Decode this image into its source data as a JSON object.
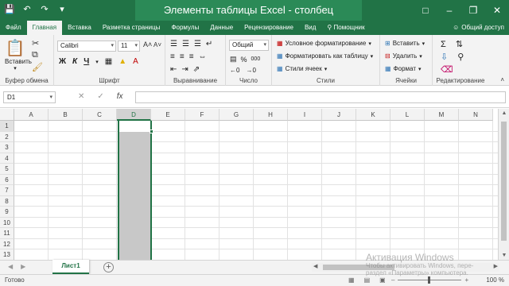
{
  "window": {
    "title": "Элементы таблицы Excel - столбец",
    "qat_icons": [
      "save-icon",
      "undo-icon",
      "redo-icon",
      "customize-qat-icon"
    ],
    "controls": [
      "ribbon-display-icon",
      "minimize-icon",
      "restore-icon",
      "close-icon"
    ]
  },
  "tabs": {
    "items": [
      "Файл",
      "Главная",
      "Вставка",
      "Разметка страницы",
      "Формулы",
      "Данные",
      "Рецензирование",
      "Вид"
    ],
    "active": "Главная",
    "help": "Помощник",
    "share": "Общий доступ"
  },
  "ribbon": {
    "clipboard": {
      "paste": "Вставить",
      "label": "Буфер обмена"
    },
    "font": {
      "name": "Calibri",
      "size": "11",
      "bold": "Ж",
      "italic": "К",
      "underline": "Ч",
      "label": "Шрифт"
    },
    "alignment": {
      "label": "Выравнивание"
    },
    "number": {
      "format": "Общий",
      "percent": "%",
      "thousands": "000",
      "label": "Число"
    },
    "styles": {
      "conditional": "Условное форматирование",
      "as_table": "Форматировать как таблицу",
      "cell_styles": "Стили ячеек",
      "label": "Стили"
    },
    "cells": {
      "insert": "Вставить",
      "delete": "Удалить",
      "format": "Формат",
      "label": "Ячейки"
    },
    "editing": {
      "label": "Редактирование"
    }
  },
  "formula_bar": {
    "name_box": "D1",
    "fx": "fx",
    "value": ""
  },
  "grid": {
    "columns": [
      "A",
      "B",
      "C",
      "D",
      "E",
      "F",
      "G",
      "H",
      "I",
      "J",
      "K",
      "L",
      "M",
      "N"
    ],
    "rows": [
      "1",
      "2",
      "3",
      "4",
      "5",
      "6",
      "7",
      "8",
      "9",
      "10",
      "11",
      "12",
      "13"
    ],
    "selected_column": "D",
    "accent": "#217346"
  },
  "sheets": {
    "tabs": [
      "Лист1"
    ],
    "active": "Лист1"
  },
  "status": {
    "ready": "Готово",
    "zoom": "100 %"
  },
  "watermark": {
    "line1": "Активация Windows",
    "line2": "Чтобы активировать Windows, пере-",
    "line3": "раздел «Параметры» компьютера."
  }
}
